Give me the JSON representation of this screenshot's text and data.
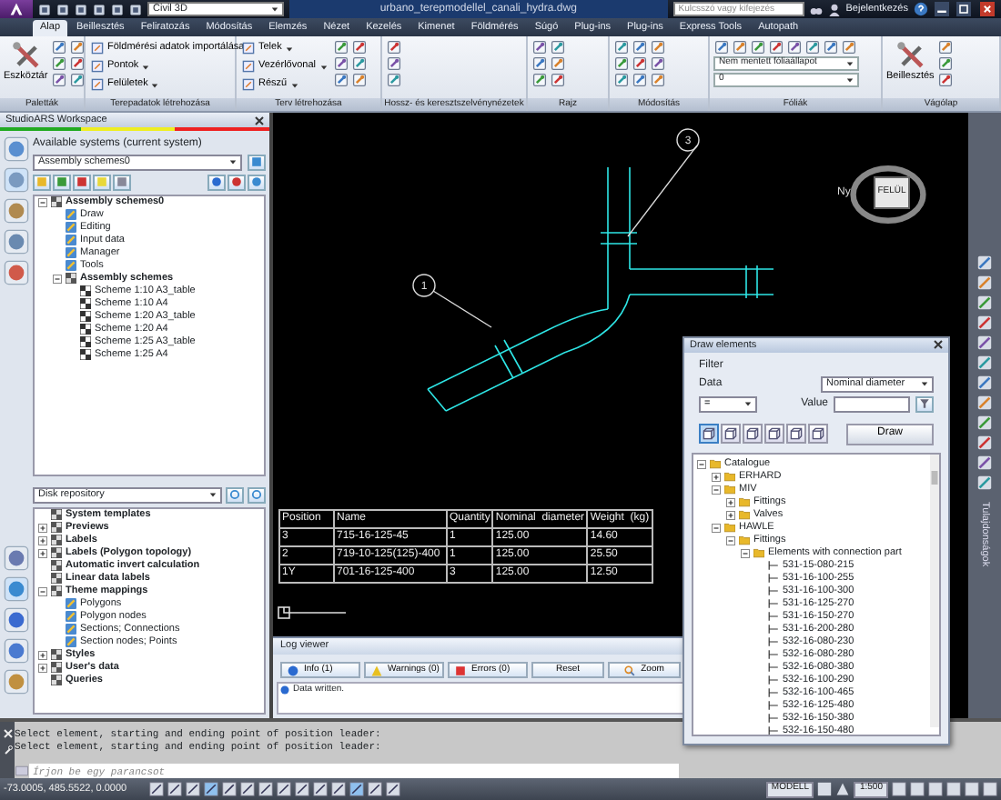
{
  "title_bar": {
    "workspace": "Civil 3D",
    "document_title": "urbano_terepmodellel_canali_hydra.dwg",
    "search_placeholder": "Kulcsszó vagy kifejezés",
    "sign_in": "Bejelentkezés"
  },
  "ribbon_tabs": [
    {
      "label": "Alap",
      "selected": true
    },
    {
      "label": "Beillesztés",
      "selected": false
    },
    {
      "label": "Feliratozás",
      "selected": false
    },
    {
      "label": "Módosítás",
      "selected": false
    },
    {
      "label": "Elemzés",
      "selected": false
    },
    {
      "label": "Nézet",
      "selected": false
    },
    {
      "label": "Kezelés",
      "selected": false
    },
    {
      "label": "Kimenet",
      "selected": false
    },
    {
      "label": "Földmérés",
      "selected": false
    },
    {
      "label": "Súgó",
      "selected": false
    },
    {
      "label": "Plug-ins",
      "selected": false
    },
    {
      "label": "Plug-ins",
      "selected": false
    },
    {
      "label": "Express Tools",
      "selected": false
    },
    {
      "label": "Autopath",
      "selected": false
    }
  ],
  "ribbon_panels": [
    {
      "title": "Paletták",
      "items": [
        {
          "kind": "big",
          "label": "Eszköztár"
        }
      ]
    },
    {
      "title": "Terepadatok létrehozása",
      "items": [
        {
          "kind": "text",
          "label": "Földmérési adatok importálása",
          "dropdown": false
        },
        {
          "kind": "text",
          "label": "Pontok",
          "dropdown": true
        },
        {
          "kind": "text",
          "label": "Felületek",
          "dropdown": true
        }
      ]
    },
    {
      "title": "Terv létrehozása",
      "items": [
        {
          "kind": "text",
          "label": "Telek",
          "dropdown": true
        },
        {
          "kind": "text",
          "label": "Vezérlővonal",
          "dropdown": true
        },
        {
          "kind": "text",
          "label": "Részű",
          "dropdown": true
        }
      ]
    },
    {
      "title": "Hossz- és keresztszelvénynézetek"
    },
    {
      "title": "Rajz"
    },
    {
      "title": "Módosítás"
    },
    {
      "title": "Fóliák",
      "items": [
        {
          "kind": "select",
          "label": "Nem mentett fóliaállapot"
        },
        {
          "kind": "select",
          "label": "0"
        }
      ]
    },
    {
      "title": "Vágólap",
      "items": [
        {
          "kind": "big",
          "label": "Beillesztés"
        }
      ]
    }
  ],
  "workspace_panel": {
    "title": "StudioARS Workspace",
    "systems_label": "Available systems (current system)",
    "system_select": "Assembly schemes0",
    "tree": [
      {
        "label": "Assembly schemes0",
        "kind": "group",
        "expanded": true,
        "children": [
          {
            "label": "Draw",
            "kind": "item"
          },
          {
            "label": "Editing",
            "kind": "item"
          },
          {
            "label": "Input data",
            "kind": "item"
          },
          {
            "label": "Manager",
            "kind": "item"
          },
          {
            "label": "Tools",
            "kind": "item"
          },
          {
            "label": "Assembly schemes",
            "kind": "group",
            "expanded": true,
            "children": [
              {
                "label": "Scheme 1:10 A3_table",
                "kind": "scheme"
              },
              {
                "label": "Scheme 1:10 A4",
                "kind": "scheme"
              },
              {
                "label": "Scheme 1:20 A3_table",
                "kind": "scheme"
              },
              {
                "label": "Scheme 1:20 A4",
                "kind": "scheme"
              },
              {
                "label": "Scheme 1:25 A3_table",
                "kind": "scheme"
              },
              {
                "label": "Scheme 1:25 A4",
                "kind": "scheme"
              }
            ]
          }
        ]
      }
    ],
    "repository_select": "Disk repository",
    "repository_tree": [
      {
        "label": "System templates",
        "kind": "group"
      },
      {
        "label": "Previews",
        "kind": "group",
        "expanded": false
      },
      {
        "label": "Labels",
        "kind": "group",
        "expanded": false
      },
      {
        "label": "Labels (Polygon topology)",
        "kind": "group",
        "expanded": false
      },
      {
        "label": "Automatic invert calculation",
        "kind": "group"
      },
      {
        "label": "Linear data labels",
        "kind": "group"
      },
      {
        "label": "Theme mappings",
        "kind": "group",
        "expanded": true,
        "children": [
          {
            "label": "Polygons",
            "kind": "item"
          },
          {
            "label": "Polygon nodes",
            "kind": "item"
          },
          {
            "label": "Sections; Connections",
            "kind": "item"
          },
          {
            "label": "Section nodes; Points",
            "kind": "item"
          }
        ]
      },
      {
        "label": "Styles",
        "kind": "group",
        "expanded": false
      },
      {
        "label": "User's data",
        "kind": "group",
        "expanded": false
      },
      {
        "label": "Queries",
        "kind": "group"
      }
    ]
  },
  "drawing": {
    "leaders": [
      "1",
      "3"
    ],
    "viewcube_face": "FELÜL",
    "compass_west": "Ny",
    "table": {
      "columns": [
        "Position",
        "Name",
        "Quantity",
        "Nominal  diameter",
        "Weight  (kg)"
      ],
      "rows": [
        [
          "3",
          "715-16-125-45",
          "1",
          "125.00",
          "14.60"
        ],
        [
          "2",
          "719-10-125(125)-400",
          "1",
          "125.00",
          "25.50"
        ],
        [
          "1Y",
          "701-16-125-400",
          "3",
          "125.00",
          "12.50"
        ]
      ]
    }
  },
  "side_palette": {
    "title": "Tulajdonságok"
  },
  "log_viewer": {
    "title": "Log viewer",
    "tabs": [
      {
        "kind": "info",
        "label": "Info (1)"
      },
      {
        "kind": "warning",
        "label": "Warnings (0)"
      },
      {
        "kind": "error",
        "label": "Errors (0)"
      }
    ],
    "buttons": [
      "Reset",
      "Zoom"
    ],
    "messages": [
      "Data written."
    ]
  },
  "draw_elements": {
    "title": "Draw elements",
    "filter_label": "Filter",
    "data_label": "Data",
    "data_select": "Nominal diameter",
    "operator_select": "=",
    "value_label": "Value",
    "view_buttons": [
      {
        "selected": true
      },
      {
        "selected": false
      },
      {
        "selected": false
      },
      {
        "selected": false
      },
      {
        "selected": false
      },
      {
        "selected": false
      }
    ],
    "draw_button": "Draw",
    "tree": [
      {
        "label": "Catalogue",
        "kind": "folder",
        "expanded": true,
        "children": [
          {
            "label": "ERHARD",
            "kind": "folder",
            "expanded": false
          },
          {
            "label": "MIV",
            "kind": "folder",
            "expanded": true,
            "children": [
              {
                "label": "Fittings",
                "kind": "folder",
                "expanded": false
              },
              {
                "label": "Valves",
                "kind": "folder",
                "expanded": false
              }
            ]
          },
          {
            "label": "HAWLE",
            "kind": "folder",
            "expanded": true,
            "children": [
              {
                "label": "Fittings",
                "kind": "folder",
                "expanded": true,
                "children": [
                  {
                    "label": "Elements with connection part",
                    "kind": "folder",
                    "expanded": true,
                    "children": [
                      {
                        "label": "531-15-080-215",
                        "kind": "leaf"
                      },
                      {
                        "label": "531-16-100-255",
                        "kind": "leaf"
                      },
                      {
                        "label": "531-16-100-300",
                        "kind": "leaf"
                      },
                      {
                        "label": "531-16-125-270",
                        "kind": "leaf"
                      },
                      {
                        "label": "531-16-150-270",
                        "kind": "leaf"
                      },
                      {
                        "label": "531-16-200-280",
                        "kind": "leaf"
                      },
                      {
                        "label": "532-16-080-230",
                        "kind": "leaf"
                      },
                      {
                        "label": "532-16-080-280",
                        "kind": "leaf"
                      },
                      {
                        "label": "532-16-080-380",
                        "kind": "leaf"
                      },
                      {
                        "label": "532-16-100-290",
                        "kind": "leaf"
                      },
                      {
                        "label": "532-16-100-465",
                        "kind": "leaf"
                      },
                      {
                        "label": "532-16-125-480",
                        "kind": "leaf"
                      },
                      {
                        "label": "532-16-150-380",
                        "kind": "leaf"
                      },
                      {
                        "label": "532-16-150-480",
                        "kind": "leaf"
                      }
                    ]
                  }
                ]
              }
            ]
          }
        ]
      }
    ]
  },
  "command_line": {
    "history": [
      "Select element, starting and ending point of position leader:",
      "Select element, starting and ending point of position leader:"
    ],
    "placeholder": "Írjon be egy parancsot"
  },
  "status_bar": {
    "coordinates": "-73.0005, 485.5522, 0.0000",
    "model": "MODELL",
    "scale": "1:500"
  }
}
